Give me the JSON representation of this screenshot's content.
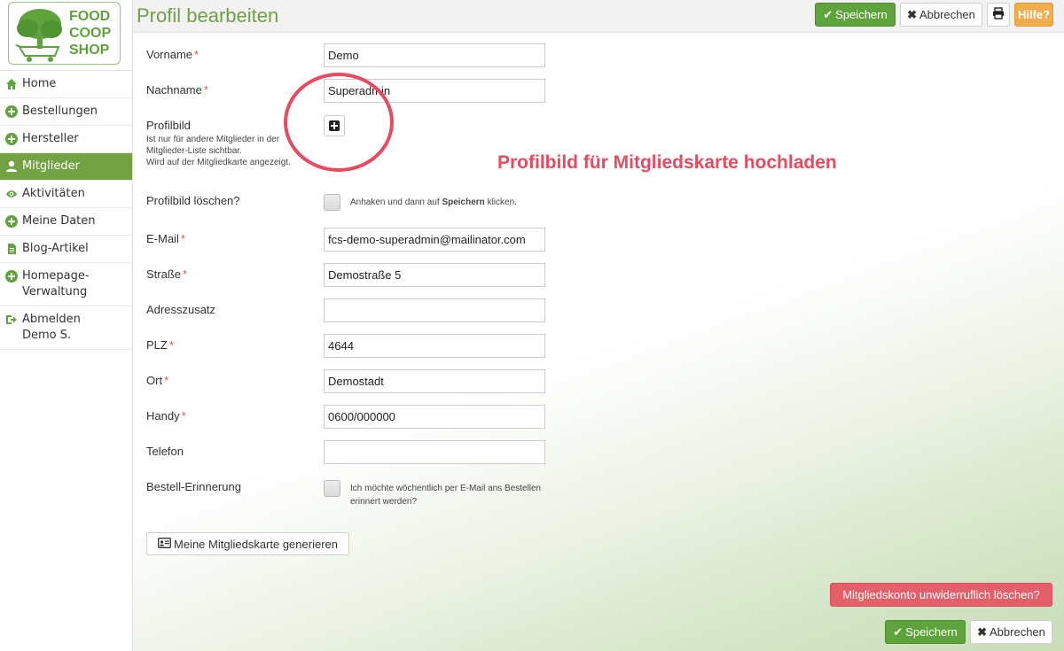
{
  "logo": {
    "line1": "FOOD",
    "line2": "COOP",
    "line3": "SHOP"
  },
  "sidebar": {
    "items": [
      {
        "label": "Home",
        "icon": "home-icon"
      },
      {
        "label": "Bestellungen",
        "icon": "plus-circle-icon"
      },
      {
        "label": "Hersteller",
        "icon": "plus-circle-icon"
      },
      {
        "label": "Mitglieder",
        "icon": "user-icon",
        "active": true
      },
      {
        "label": "Aktivitäten",
        "icon": "eye-icon"
      },
      {
        "label": "Meine Daten",
        "icon": "plus-circle-icon"
      },
      {
        "label": "Blog-Artikel",
        "icon": "document-icon"
      },
      {
        "label": "Homepage-",
        "label2": "Verwaltung",
        "icon": "plus-circle-icon"
      },
      {
        "label": "Abmelden",
        "label2": "Demo S.",
        "icon": "sign-out-icon"
      }
    ]
  },
  "header": {
    "title": "Profil bearbeiten",
    "save_label": "Speichern",
    "cancel_label": "Abbrechen",
    "help_label": "Hilfe?"
  },
  "form": {
    "required_mark": "*",
    "vorname": {
      "label": "Vorname",
      "value": "Demo"
    },
    "nachname": {
      "label": "Nachname",
      "value": "Superadmin"
    },
    "profilbild": {
      "label": "Profilbild",
      "hint1": "Ist nur für andere Mitglieder in der",
      "hint2": "Mitglieder-Liste sichtbar.",
      "hint3": "Wird auf der Mitgliedkarte angezeigt."
    },
    "profilbild_loeschen": {
      "label": "Profilbild löschen?",
      "hint_before": "Anhaken und dann auf ",
      "hint_bold": "Speichern",
      "hint_after": " klicken."
    },
    "email": {
      "label": "E-Mail",
      "value": "fcs-demo-superadmin@mailinator.com"
    },
    "strasse": {
      "label": "Straße",
      "value": "Demostraße 5"
    },
    "adresszusatz": {
      "label": "Adresszusatz",
      "value": ""
    },
    "plz": {
      "label": "PLZ",
      "value": "4644"
    },
    "ort": {
      "label": "Ort",
      "value": "Demostadt"
    },
    "handy": {
      "label": "Handy",
      "value": "0600/000000"
    },
    "telefon": {
      "label": "Telefon",
      "value": ""
    },
    "bestell_erinnerung": {
      "label": "Bestell-Erinnerung",
      "hint1": "Ich möchte wöchentlich per E-Mail ans Bestellen",
      "hint2": "erinnert werden?"
    },
    "card_button": "Meine Mitgliedskarte generieren",
    "delete_account": "Mitgliedskonto unwiderruflich löschen?",
    "save_label": "Speichern",
    "cancel_label": "Abbrechen"
  },
  "annotation": {
    "text": "Profilbild für Mitgliedskarte hochladen",
    "color": "#e84a5f"
  },
  "colors": {
    "brand_green": "#5ea33b",
    "active_nav": "#72a242",
    "help_orange": "#f0ad4e",
    "danger": "#e35f69"
  }
}
